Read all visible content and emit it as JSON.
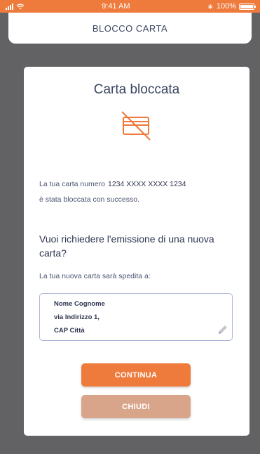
{
  "status_bar": {
    "time": "9:41 AM",
    "battery": "100%"
  },
  "header": {
    "title": "BLOCCO CARTA"
  },
  "card": {
    "title": "Carta bloccata",
    "message_line1_prefix": "La tua carta numero",
    "card_number": "1234 XXXX XXXX 1234",
    "message_line2": "è stata bloccata con successo.",
    "question": "Vuoi richiedere l'emissione di una nuova carta?",
    "ship_label": "La tua nuova carta sarà spedita a:",
    "address": {
      "line1": "Nome Cognome",
      "line2": "via Indirizzo 1,",
      "line3": "CAP Città"
    },
    "continue_label": "CONTINUA",
    "close_label": "CHIUDI"
  },
  "colors": {
    "accent": "#ee7a3c",
    "secondary": "#d9a58a",
    "text": "#2e3550"
  }
}
